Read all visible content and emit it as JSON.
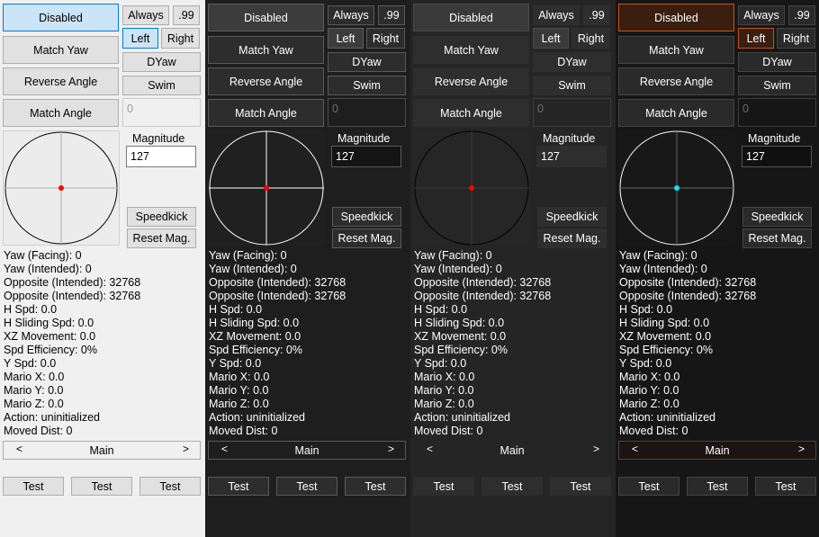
{
  "panels": [
    {
      "theme": "light",
      "mode_button": "Disabled",
      "always_label": "Always",
      "ninety_nine_label": ".99",
      "left_label": "Left",
      "right_label": "Right",
      "match_yaw_label": "Match Yaw",
      "dyaw_label": "DYaw",
      "reverse_angle_label": "Reverse Angle",
      "swim_label": "Swim",
      "match_angle_label": "Match Angle",
      "angle_value": "0",
      "magnitude_label": "Magnitude",
      "magnitude_value": "127",
      "speedkick_label": "Speedkick",
      "reset_mag_label": "Reset Mag.",
      "stats": [
        "Yaw (Facing): 0",
        "Yaw (Intended): 0",
        "Opposite (Intended): 32768",
        "Opposite (Intended): 32768",
        "H Spd: 0.0",
        "H Sliding Spd: 0.0",
        "XZ Movement: 0.0",
        "Spd Efficiency: 0%",
        "Y Spd: 0.0",
        "Mario X: 0.0",
        "Mario Y: 0.0",
        "Mario Z: 0.0",
        "Action: uninitialized",
        "Moved Dist: 0"
      ],
      "tab_prev": "<",
      "tab_name": "Main",
      "tab_next": ">",
      "test_buttons": [
        "Test",
        "Test",
        "Test"
      ],
      "circle_color": "#000000",
      "crosshair_color": "#b0b0b0",
      "dot_color": "#ff0000"
    },
    {
      "theme": "dark",
      "mode_button": "Disabled",
      "always_label": "Always",
      "ninety_nine_label": ".99",
      "left_label": "Left",
      "right_label": "Right",
      "match_yaw_label": "Match Yaw",
      "dyaw_label": "DYaw",
      "reverse_angle_label": "Reverse Angle",
      "swim_label": "Swim",
      "match_angle_label": "Match Angle",
      "angle_value": "0",
      "magnitude_label": "Magnitude",
      "magnitude_value": "127",
      "speedkick_label": "Speedkick",
      "reset_mag_label": "Reset Mag.",
      "stats": [
        "Yaw (Facing): 0",
        "Yaw (Intended): 0",
        "Opposite (Intended): 32768",
        "Opposite (Intended): 32768",
        "H Spd: 0.0",
        "H Sliding Spd: 0.0",
        "XZ Movement: 0.0",
        "Spd Efficiency: 0%",
        "Y Spd: 0.0",
        "Mario X: 0.0",
        "Mario Y: 0.0",
        "Mario Z: 0.0",
        "Action: uninitialized",
        "Moved Dist: 0"
      ],
      "tab_prev": "<",
      "tab_name": "Main",
      "tab_next": ">",
      "test_buttons": [
        "Test",
        "Test",
        "Test"
      ],
      "circle_color": "#ffffff",
      "crosshair_color": "#ffffff",
      "dot_color": "#ff0000"
    },
    {
      "theme": "flat",
      "mode_button": "Disabled",
      "always_label": "Always",
      "ninety_nine_label": ".99",
      "left_label": "Left",
      "right_label": "Right",
      "match_yaw_label": "Match Yaw",
      "dyaw_label": "DYaw",
      "reverse_angle_label": "Reverse Angle",
      "swim_label": "Swim",
      "match_angle_label": "Match Angle",
      "angle_value": "0",
      "magnitude_label": "Magnitude",
      "magnitude_value": "127",
      "speedkick_label": "Speedkick",
      "reset_mag_label": "Reset Mag.",
      "stats": [
        "Yaw (Facing): 0",
        "Yaw (Intended): 0",
        "Opposite (Intended): 32768",
        "Opposite (Intended): 32768",
        "H Spd: 0.0",
        "H Sliding Spd: 0.0",
        "XZ Movement: 0.0",
        "Spd Efficiency: 0%",
        "Y Spd: 0.0",
        "Mario X: 0.0",
        "Mario Y: 0.0",
        "Mario Z: 0.0",
        "Action: uninitialized",
        "Moved Dist: 0"
      ],
      "tab_prev": "<",
      "tab_name": "Main",
      "tab_next": ">",
      "test_buttons": [
        "Test",
        "Test",
        "Test"
      ],
      "circle_color": "#000000",
      "crosshair_color": "#3a3a3a",
      "dot_color": "#ff0000"
    },
    {
      "theme": "orange",
      "mode_button": "Disabled",
      "always_label": "Always",
      "ninety_nine_label": ".99",
      "left_label": "Left",
      "right_label": "Right",
      "match_yaw_label": "Match Yaw",
      "dyaw_label": "DYaw",
      "reverse_angle_label": "Reverse Angle",
      "swim_label": "Swim",
      "match_angle_label": "Match Angle",
      "angle_value": "0",
      "magnitude_label": "Magnitude",
      "magnitude_value": "127",
      "speedkick_label": "Speedkick",
      "reset_mag_label": "Reset Mag.",
      "stats": [
        "Yaw (Facing): 0",
        "Yaw (Intended): 0",
        "Opposite (Intended): 32768",
        "Opposite (Intended): 32768",
        "H Spd: 0.0",
        "H Sliding Spd: 0.0",
        "XZ Movement: 0.0",
        "Spd Efficiency: 0%",
        "Y Spd: 0.0",
        "Mario X: 0.0",
        "Mario Y: 0.0",
        "Mario Z: 0.0",
        "Action: uninitialized",
        "Moved Dist: 0"
      ],
      "tab_prev": "<",
      "tab_name": "Main",
      "tab_next": ">",
      "test_buttons": [
        "Test",
        "Test",
        "Test"
      ],
      "circle_color": "#ffffff",
      "crosshair_color": "#666666",
      "dot_color": "#00e5ff"
    }
  ]
}
